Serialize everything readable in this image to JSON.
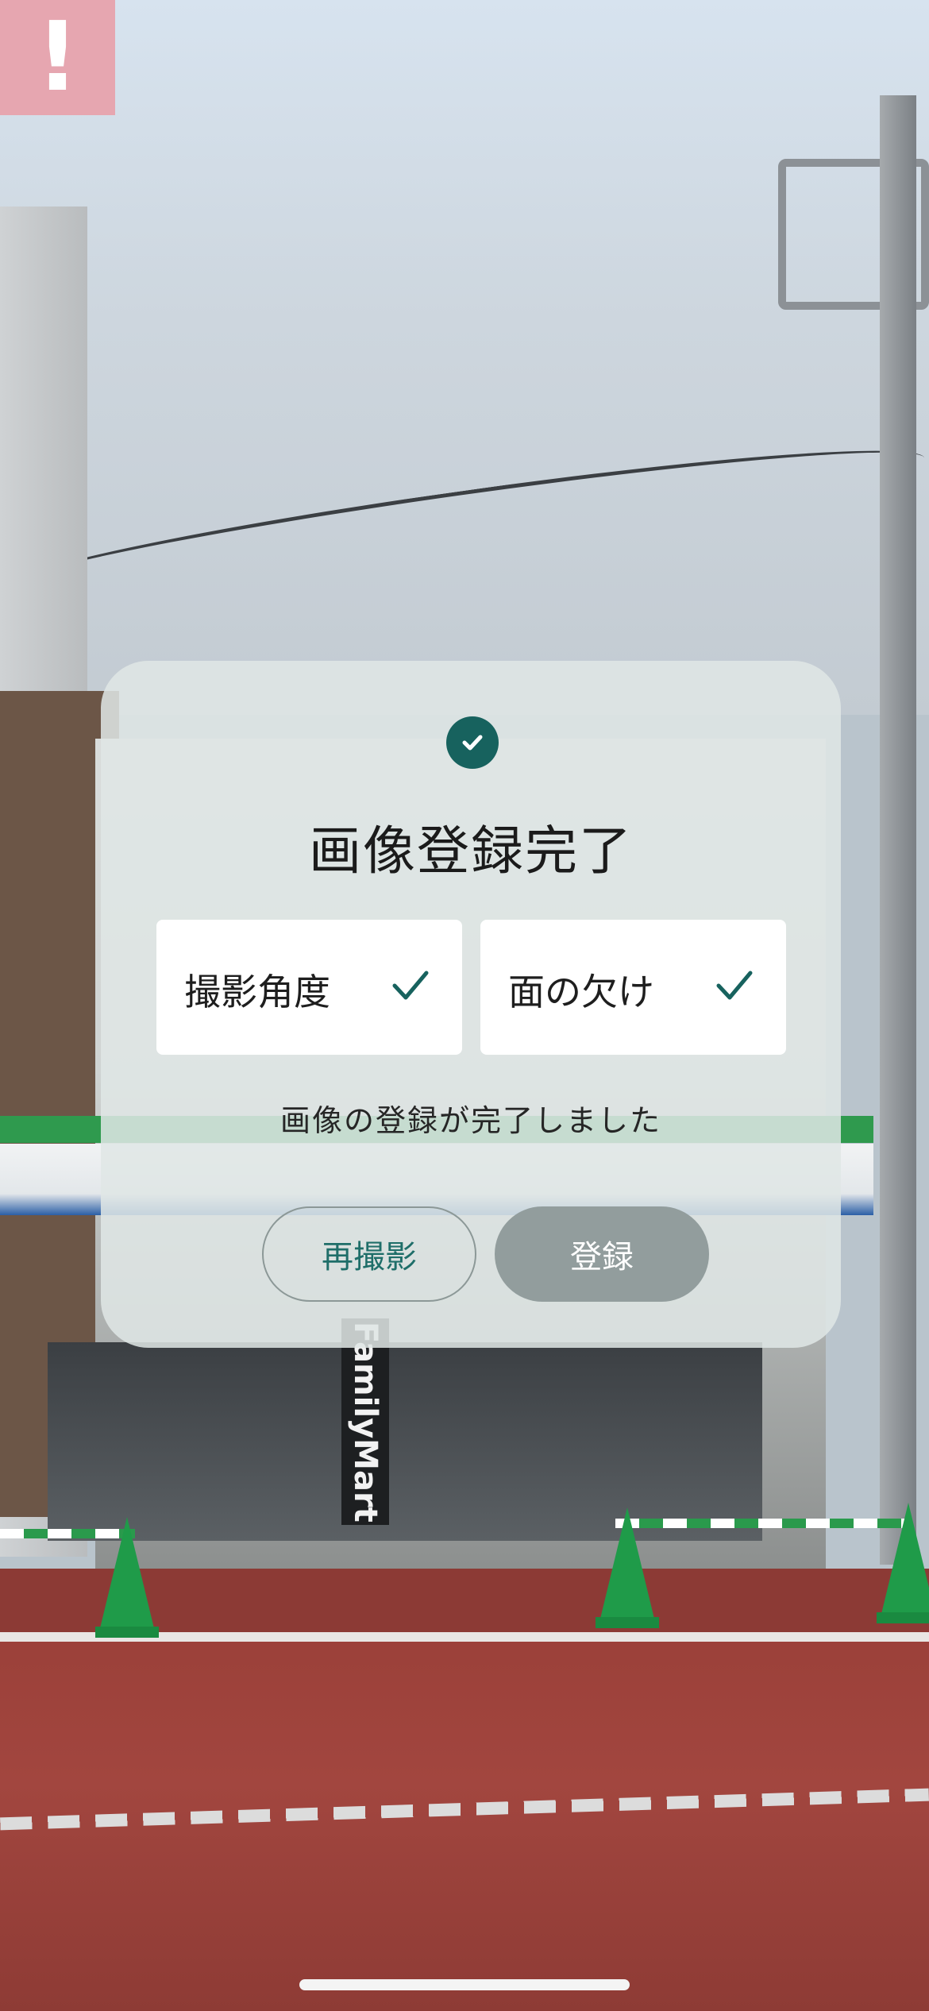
{
  "alert": {
    "glyph": "!"
  },
  "scene": {
    "store_sign": "FamilyMart"
  },
  "dialog": {
    "title": "画像登録完了",
    "checks": [
      {
        "label": "撮影角度",
        "checked": true
      },
      {
        "label": "面の欠け",
        "checked": true
      }
    ],
    "message": "画像の登録が完了しました",
    "retake_label": "再撮影",
    "register_label": "登録"
  },
  "colors": {
    "accent": "#17625e",
    "alert": "#e6a6b0",
    "register_button": "#929d9d",
    "retake_text": "#1f6e69"
  },
  "icons": {
    "status": "check-circle-icon",
    "item_check": "checkmark-icon",
    "alert": "exclamation-icon"
  }
}
